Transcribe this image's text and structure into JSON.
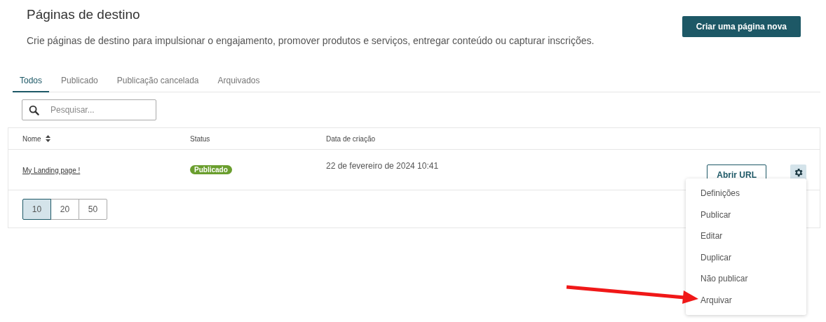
{
  "header": {
    "title": "Páginas de destino",
    "description": "Crie páginas de destino para impulsionar o engajamento, promover produtos e serviços, entregar conteúdo ou capturar inscrições.",
    "create_button": "Criar uma página nova"
  },
  "tabs": [
    {
      "label": "Todos",
      "selected": true
    },
    {
      "label": "Publicado",
      "selected": false
    },
    {
      "label": "Publicação cancelada",
      "selected": false
    },
    {
      "label": "Arquivados",
      "selected": false
    }
  ],
  "search": {
    "placeholder": "Pesquisar..."
  },
  "table": {
    "columns": [
      "Nome",
      "Status",
      "Data de criação"
    ],
    "rows": [
      {
        "name": "My Landing page !",
        "status": "Publicado",
        "created": "22 de fevereiro de 2024 10:41",
        "action": "Abrir URL"
      }
    ]
  },
  "page_sizes": [
    {
      "label": "10",
      "selected": true
    },
    {
      "label": "20",
      "selected": false
    },
    {
      "label": "50",
      "selected": false
    }
  ],
  "menu": {
    "items": [
      "Definições",
      "Publicar",
      "Editar",
      "Duplicar",
      "Não publicar",
      "Arquivar"
    ]
  }
}
